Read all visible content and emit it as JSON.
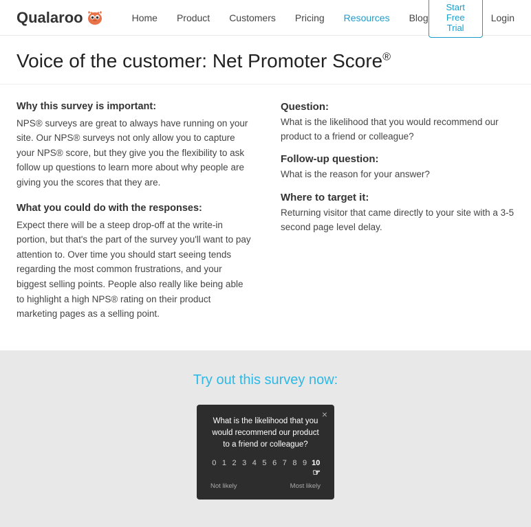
{
  "nav": {
    "logo_text": "Qualaroo",
    "links": [
      {
        "label": "Home",
        "active": false
      },
      {
        "label": "Product",
        "active": false
      },
      {
        "label": "Customers",
        "active": false
      },
      {
        "label": "Pricing",
        "active": false
      },
      {
        "label": "Resources",
        "active": true
      },
      {
        "label": "Blog",
        "active": false
      }
    ],
    "cta_label": "Start Free Trial",
    "login_label": "Login"
  },
  "page": {
    "title": "Voice of the customer: Net Promoter Score",
    "title_sup": "®"
  },
  "left": {
    "section1_heading": "Why this survey is important:",
    "section1_text": "NPS® surveys are great to always have running on your site. Our NPS® surveys not only allow you to capture your NPS® score, but they give you the flexibility to ask follow up questions to learn more about why people are giving you the scores that they are.",
    "section2_heading": "What you could do with the responses:",
    "section2_text": "Expect there will be a steep drop-off at the write-in portion, but that's the part of the survey you'll want to pay attention to. Over time you should start seeing tends regarding the most common frustrations, and your biggest selling points. People also really like being able to highlight a high NPS® rating on their product marketing pages as a selling point."
  },
  "right": {
    "q1_label": "Question:",
    "q1_text": "What is the likelihood that you would recommend our product to a friend or colleague?",
    "q2_label": "Follow-up question:",
    "q2_text": "What is the reason for your answer?",
    "q3_label": "Where to target it:",
    "q3_text": "Returning visitor that came directly to your site with a 3-5 second page level delay."
  },
  "demo": {
    "title_plain": "out this survey now:",
    "title_colored": "Try",
    "widget_question": "What is the likelihood that you would recommend our product to a friend or colleague?",
    "numbers": [
      "0",
      "1",
      "2",
      "3",
      "4",
      "5",
      "6",
      "7",
      "8",
      "9",
      "10"
    ],
    "label_left": "Not likely",
    "label_right": "Most likely",
    "close_icon": "×"
  }
}
